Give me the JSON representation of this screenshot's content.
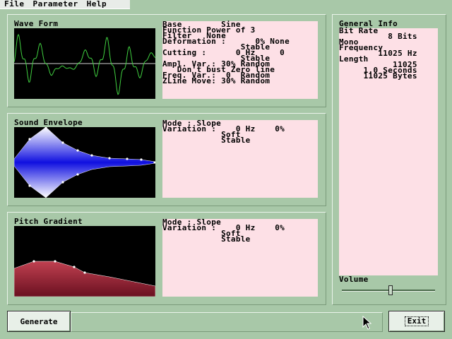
{
  "menu": [
    "File",
    "Parameter",
    "Help"
  ],
  "waveform": {
    "title": "Wave Form",
    "lines": [
      "Base        Sine",
      "Function Power of 3",
      "Filter   None",
      "Deformation :      0% None",
      "                Stable",
      "Cutting :      0 Hz     0",
      "                Stable",
      "Ampl. Var.: 30% Random",
      "   Don't bust Zero line",
      "Freq. Var.:  0  Random",
      "ZLine Move: 30% Random"
    ]
  },
  "envelope": {
    "title": "Sound Envelope",
    "lines": [
      "Mode : Slope",
      "Variation :    0 Hz    0%",
      "            Soft",
      "            Stable"
    ]
  },
  "pitch": {
    "title": "Pitch Gradient",
    "lines": [
      "Mode : Slope",
      "Variation :    0 Hz    0%",
      "            Soft",
      "            Stable"
    ]
  },
  "general": {
    "title": "General Info",
    "lines": [
      "Bit Rate",
      "          8 Bits",
      "Mono",
      "",
      "Frequency",
      "        11025 Hz",
      "Length",
      "           11025",
      "     1.0 Seconds",
      "     11025 Bytes"
    ],
    "volume_label": "Volume",
    "volume_level": 0.52
  },
  "buttons": {
    "generate": "Generate",
    "exit": "Exit"
  },
  "colors": {
    "background": "#a8c8a8",
    "wave": "#40d040",
    "envelope": "#1010e0",
    "pitch": "#a03040",
    "info_bg": "#fde0e6"
  }
}
